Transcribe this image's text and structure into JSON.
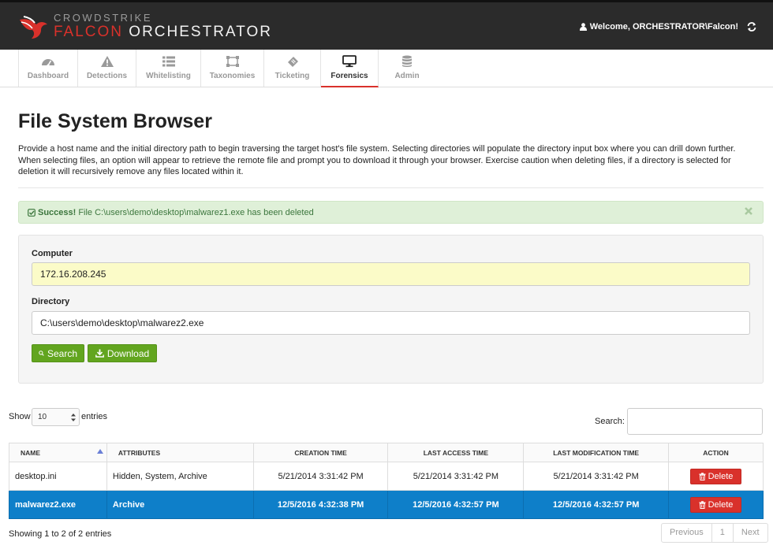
{
  "brand": {
    "line1": "CROWDSTRIKE",
    "line2_red": "FALCON",
    "line2_white": " ORCHESTRATOR"
  },
  "header": {
    "welcome": "Welcome, ORCHESTRATOR\\Falcon!"
  },
  "tabs": [
    {
      "label": "Dashboard",
      "icon": "dashboard-icon"
    },
    {
      "label": "Detections",
      "icon": "warning-icon"
    },
    {
      "label": "Whitelisting",
      "icon": "list-icon"
    },
    {
      "label": "Taxonomies",
      "icon": "taxonomy-icon"
    },
    {
      "label": "Ticketing",
      "icon": "ticket-icon"
    },
    {
      "label": "Forensics",
      "icon": "monitor-icon",
      "active": true
    },
    {
      "label": "Admin",
      "icon": "database-icon"
    }
  ],
  "page": {
    "title": "File System Browser",
    "description": "Provide a host name and the initial directory path to begin traversing the target host's file system. Selecting directories will populate the directory input box where you can drill down further. When selecting files, an option will appear to retrieve the remote file and prompt you to download it through your browser. Exercise caution when deleting files, if a directory is selected for deletion it will recursively remove any files located within it."
  },
  "alert": {
    "strong": "Success!",
    "message": "File C:\\users\\demo\\desktop\\malwarez1.exe has been deleted"
  },
  "form": {
    "computer_label": "Computer",
    "computer_value": "172.16.208.245",
    "directory_label": "Directory",
    "directory_value": "C:\\users\\demo\\desktop\\malwarez2.exe",
    "search_button": "Search",
    "download_button": "Download"
  },
  "table_controls": {
    "show": "Show",
    "length": "10",
    "entries": "entries",
    "search_label": "Search:"
  },
  "table": {
    "columns": [
      "NAME",
      "ATTRIBUTES",
      "CREATION TIME",
      "LAST ACCESS TIME",
      "LAST MODIFICATION TIME",
      "ACTION"
    ],
    "rows": [
      {
        "name": "desktop.ini",
        "attributes": "Hidden, System, Archive",
        "created": "5/21/2014 3:31:42 PM",
        "accessed": "5/21/2014 3:31:42 PM",
        "modified": "5/21/2014 3:31:42 PM",
        "action": "Delete"
      },
      {
        "name": "malwarez2.exe",
        "attributes": "Archive",
        "created": "12/5/2016 4:32:38 PM",
        "accessed": "12/5/2016 4:32:57 PM",
        "modified": "12/5/2016 4:32:57 PM",
        "action": "Delete",
        "selected": true
      }
    ]
  },
  "footer": {
    "info": "Showing 1 to 2 of 2 entries",
    "previous": "Previous",
    "page": "1",
    "next": "Next"
  },
  "colors": {
    "accent_red": "#d9312b",
    "success_green": "#62a51f",
    "selected_blue": "#0e7fc9",
    "topbar": "#2b2b2b"
  }
}
